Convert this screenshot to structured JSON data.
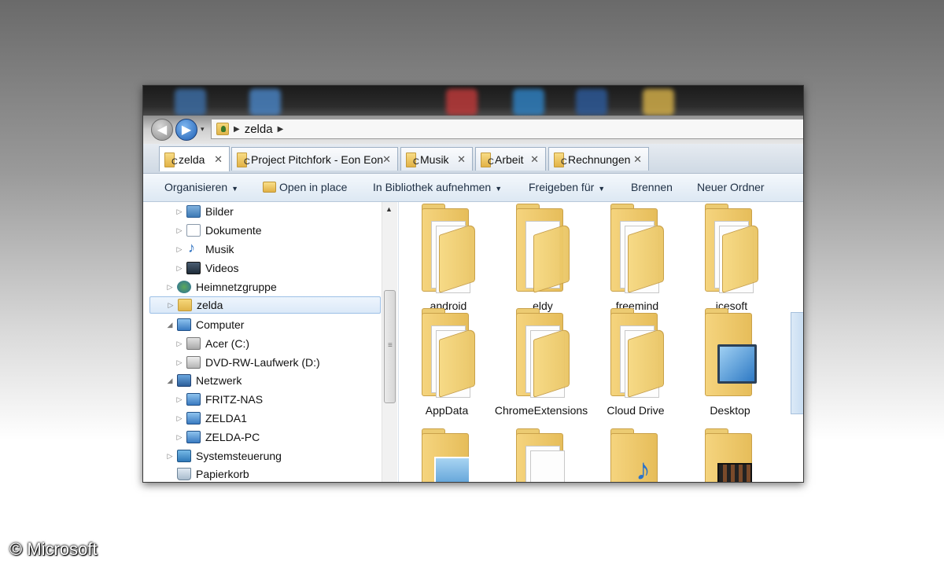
{
  "address_bar": {
    "path": [
      "zelda"
    ]
  },
  "tabs": [
    {
      "label": "zelda",
      "active": true
    },
    {
      "label": "Project Pitchfork - Eon Eon",
      "active": false
    },
    {
      "label": "Musik",
      "active": false
    },
    {
      "label": "Arbeit",
      "active": false
    },
    {
      "label": "Rechnungen",
      "active": false
    }
  ],
  "toolbar": {
    "organize": "Organisieren",
    "open_in_place": "Open in place",
    "include_library": "In Bibliothek aufnehmen",
    "share": "Freigeben für",
    "burn": "Brennen",
    "new_folder": "Neuer Ordner"
  },
  "nav_tree": [
    {
      "label": "Bilder",
      "icon": "pictures-icon",
      "expander": "▷"
    },
    {
      "label": "Dokumente",
      "icon": "documents-icon",
      "expander": "▷"
    },
    {
      "label": "Musik",
      "icon": "music-icon",
      "expander": "▷"
    },
    {
      "label": "Videos",
      "icon": "videos-icon",
      "expander": "▷"
    },
    {
      "label": "Heimnetzgruppe",
      "icon": "homegroup-icon",
      "expander": "▷"
    },
    {
      "label": "zelda",
      "icon": "user-folder-icon",
      "expander": "▷",
      "selected": true
    },
    {
      "label": "Computer",
      "icon": "computer-icon",
      "expander": "◢"
    },
    {
      "label": "Acer (C:)",
      "icon": "drive-icon",
      "expander": "▷"
    },
    {
      "label": "DVD-RW-Laufwerk (D:)",
      "icon": "dvd-drive-icon",
      "expander": "▷"
    },
    {
      "label": "Netzwerk",
      "icon": "network-icon",
      "expander": "◢"
    },
    {
      "label": "FRITZ-NAS",
      "icon": "network-computer-icon",
      "expander": "▷"
    },
    {
      "label": "ZELDA1",
      "icon": "network-computer-icon",
      "expander": "▷"
    },
    {
      "label": "ZELDA-PC",
      "icon": "network-computer-icon",
      "expander": "▷"
    },
    {
      "label": "Systemsteuerung",
      "icon": "control-panel-icon",
      "expander": "▷"
    },
    {
      "label": "Papierkorb",
      "icon": "recycle-bin-icon",
      "expander": ""
    }
  ],
  "files": [
    {
      "label": ".android",
      "icon": "folder-with-files-icon"
    },
    {
      "label": ".eldy",
      "icon": "folder-with-document-icon"
    },
    {
      "label": ".freemind",
      "icon": "folder-with-files-icon"
    },
    {
      "label": ".icesoft",
      "icon": "folder-with-files-icon"
    },
    {
      "label": "AppData",
      "icon": "folder-with-files-icon"
    },
    {
      "label": "ChromeExtensions",
      "icon": "folder-with-files-icon"
    },
    {
      "label": "Cloud Drive",
      "icon": "folder-with-files-icon"
    },
    {
      "label": "Desktop",
      "icon": "desktop-folder-icon"
    },
    {
      "label": "",
      "icon": "pictures-folder-icon"
    },
    {
      "label": "",
      "icon": "documents-folder-icon"
    },
    {
      "label": "",
      "icon": "music-folder-icon"
    },
    {
      "label": "",
      "icon": "videos-folder-icon"
    }
  ],
  "copyright": "© Microsoft"
}
